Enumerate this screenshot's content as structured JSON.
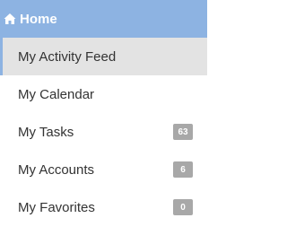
{
  "header": {
    "label": "Home",
    "icon": "home-icon",
    "background_color": "#8db3e2"
  },
  "items": [
    {
      "label": "My Activity Feed",
      "active": true,
      "badge": null
    },
    {
      "label": "My Calendar",
      "active": false,
      "badge": null
    },
    {
      "label": "My Tasks",
      "active": false,
      "badge": "63"
    },
    {
      "label": "My Accounts",
      "active": false,
      "badge": "6"
    },
    {
      "label": "My Favorites",
      "active": false,
      "badge": "0"
    }
  ],
  "colors": {
    "active_background": "#e3e3e3",
    "badge_background": "#a8a8a8",
    "text": "#333333"
  }
}
